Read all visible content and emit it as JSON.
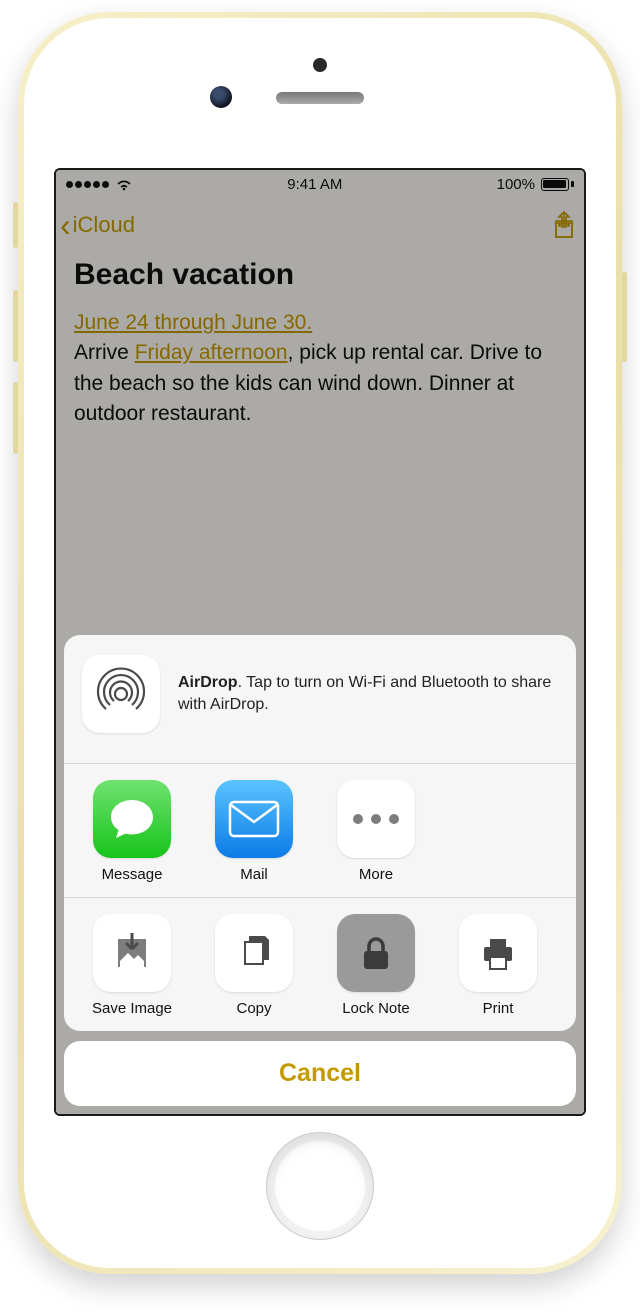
{
  "status": {
    "time": "9:41 AM",
    "battery": "100%"
  },
  "nav": {
    "back_label": "iCloud"
  },
  "note": {
    "title": "Beach vacation",
    "link1": "June 24 through June 30.",
    "line2a": "Arrive ",
    "link2": "Friday afternoon",
    "line2b": ", pick up rental car. Drive to the beach so the kids can wind down. Dinner at outdoor restaurant."
  },
  "airdrop": {
    "label_bold": "AirDrop",
    "label_rest": ". Tap to turn on Wi-Fi and Bluetooth to share with AirDrop."
  },
  "share_apps": [
    {
      "id": "message",
      "label": "Message"
    },
    {
      "id": "mail",
      "label": "Mail"
    },
    {
      "id": "more",
      "label": "More"
    }
  ],
  "actions": [
    {
      "id": "save-image",
      "label": "Save Image"
    },
    {
      "id": "copy",
      "label": "Copy"
    },
    {
      "id": "lock-note",
      "label": "Lock Note"
    },
    {
      "id": "print",
      "label": "Print"
    }
  ],
  "cancel_label": "Cancel"
}
